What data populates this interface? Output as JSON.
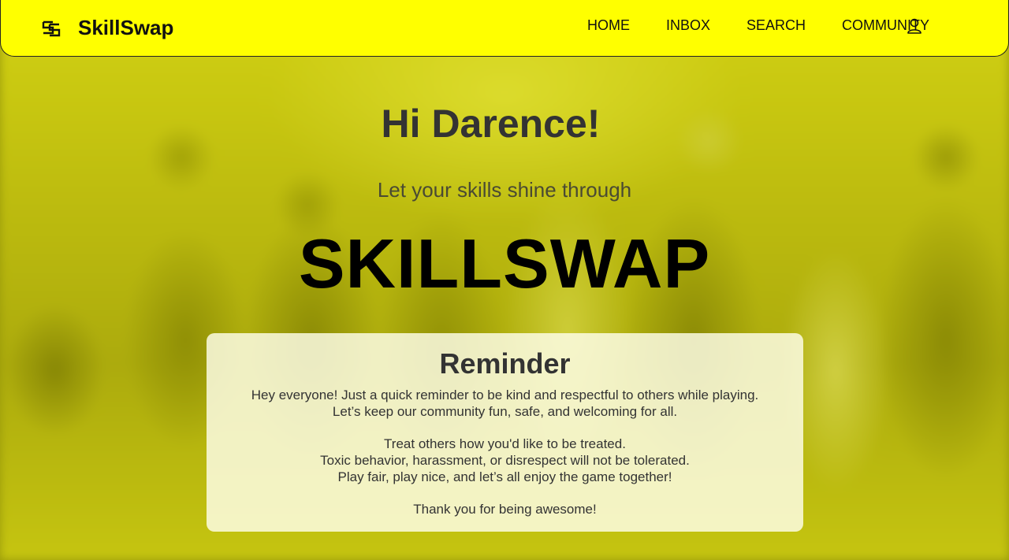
{
  "navbar": {
    "brand": "SkillSwap",
    "links": [
      "HOME",
      "INBOX",
      "SEARCH",
      "COMMUNITY"
    ]
  },
  "hero": {
    "greeting": "Hi Darence!",
    "tagline": "Let your skills shine through",
    "title": "SKILLSWAP"
  },
  "reminder": {
    "title": "Reminder",
    "intro": [
      "Hey everyone! Just a quick reminder to be kind and respectful to others while playing.",
      "Let’s keep our community fun, safe, and welcoming for all."
    ],
    "rules": [
      "Treat others how you'd like to be treated.",
      "Toxic behavior, harassment, or disrespect will not be tolerated.",
      "Play fair, play nice, and let’s all enjoy the game together!"
    ],
    "closing": "Thank you for being awesome!"
  },
  "colors": {
    "navbar_bg": "#ffff00",
    "text_dark": "#333333"
  },
  "icons": {
    "logo": "skillswap-logo-icon",
    "profile": "user-icon"
  }
}
